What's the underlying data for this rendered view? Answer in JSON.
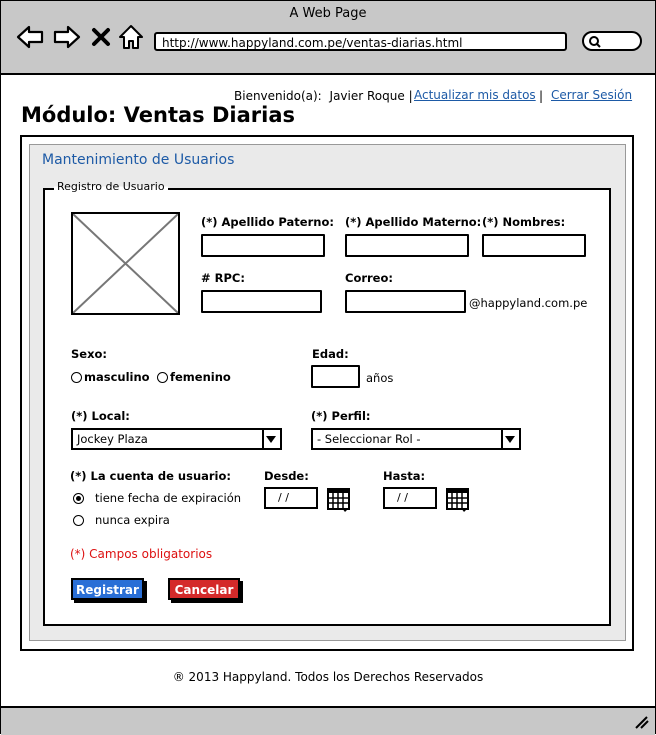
{
  "window": {
    "title": "A Web Page"
  },
  "browser": {
    "url": "http://www.happyland.com.pe/ventas-diarias.html"
  },
  "header": {
    "welcome_prefix": "Bienvenido(a):",
    "user_name": "Javier Roque",
    "separator1": "|",
    "update_link": "Actualizar mis datos",
    "separator2": "|",
    "logout_link": "Cerrar Sesión"
  },
  "page": {
    "title": "Módulo: Ventas Diarias"
  },
  "section": {
    "title": "Mantenimiento de Usuarios"
  },
  "form": {
    "legend": "Registro de Usuario",
    "apellido_paterno": {
      "label": "(*) Apellido Paterno:",
      "value": ""
    },
    "apellido_materno": {
      "label": "(*) Apellido Materno:",
      "value": ""
    },
    "nombres": {
      "label": "(*) Nombres:",
      "value": ""
    },
    "rpc": {
      "label": "# RPC:",
      "value": ""
    },
    "correo": {
      "label": "Correo:",
      "value": "",
      "domain": "@happyland.com.pe"
    },
    "sexo": {
      "label": "Sexo:",
      "options": [
        "masculino",
        "femenino"
      ]
    },
    "edad": {
      "label": "Edad:",
      "unit": "años",
      "value": ""
    },
    "local": {
      "label": "(*) Local:",
      "selected": "Jockey Plaza"
    },
    "perfil": {
      "label": "(*) Perfil:",
      "selected": "- Seleccionar Rol -"
    },
    "cuenta": {
      "label": "(*) La cuenta de usuario:",
      "options": [
        "tiene fecha de expiración",
        "nunca expira"
      ],
      "selected_index": 0
    },
    "desde": {
      "label": "Desde:",
      "value": "/ /"
    },
    "hasta": {
      "label": "Hasta:",
      "value": "/ /"
    },
    "required_note": "(*) Campos obligatorios",
    "buttons": {
      "register": "Registrar",
      "cancel": "Cancelar"
    }
  },
  "footer": {
    "text": "® 2013 Happyland. Todos los Derechos Reservados"
  },
  "colors": {
    "link": "#1d5aa6",
    "register_button": "#2a6fd6",
    "cancel_button": "#d42a2a",
    "required": "#dd1111",
    "chrome": "#c8c8c8"
  }
}
